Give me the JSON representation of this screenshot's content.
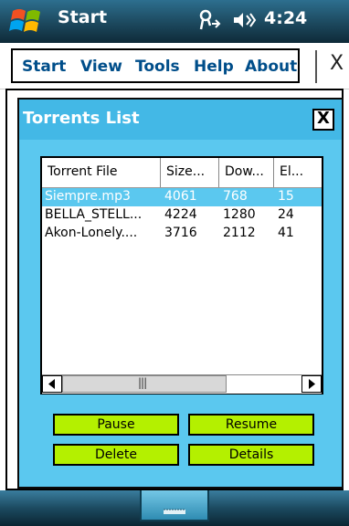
{
  "system": {
    "app_title": "Start",
    "time": "4:24",
    "icons": [
      "windows-flag-icon",
      "connectivity-icon",
      "volume-icon"
    ]
  },
  "menu": {
    "items": [
      "Start",
      "View",
      "Tools",
      "Help",
      "About"
    ],
    "close_label": "X"
  },
  "window": {
    "title": "Torrents List",
    "close_label": "X"
  },
  "list": {
    "columns": [
      "Torrent File",
      "Size...",
      "Dow...",
      "El..."
    ],
    "rows": [
      {
        "file": "Siempre.mp3",
        "size": "4061",
        "downloaded": "768",
        "elapsed": "15",
        "selected": true
      },
      {
        "file": "BELLA_STELL...",
        "size": "4224",
        "downloaded": "1280",
        "elapsed": "24",
        "selected": false
      },
      {
        "file": "Akon-Lonely....",
        "size": "3716",
        "downloaded": "2112",
        "elapsed": "41",
        "selected": false
      }
    ],
    "scrollbar": {
      "thumb_label": "|||"
    }
  },
  "buttons": {
    "pause": "Pause",
    "resume": "Resume",
    "delete": "Delete",
    "details": "Details"
  },
  "colors": {
    "accent_blue": "#5bc8ef",
    "button_green": "#b4f000",
    "menu_text": "#004e8a"
  }
}
